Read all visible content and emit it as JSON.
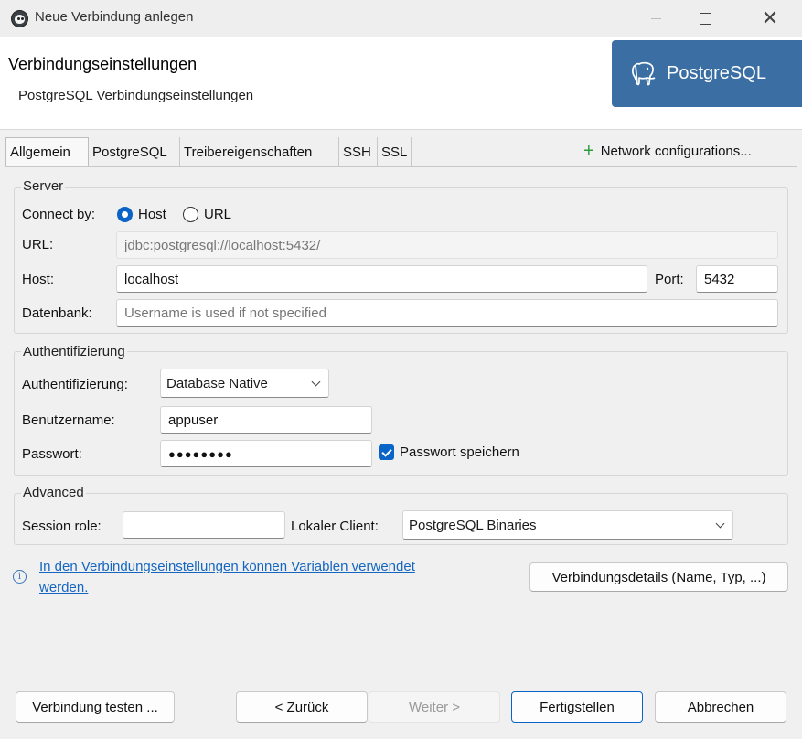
{
  "window": {
    "title": "Neue Verbindung anlegen"
  },
  "header": {
    "title": "Verbindungseinstellungen",
    "subtitle": "PostgreSQL Verbindungseinstellungen",
    "logo_text": "PostgreSQL"
  },
  "tabs": [
    {
      "label": "Allgemein",
      "active": true
    },
    {
      "label": "PostgreSQL"
    },
    {
      "label": "Treibereigenschaften"
    },
    {
      "label": "SSH"
    },
    {
      "label": "SSL"
    }
  ],
  "network_config": "Network configurations...",
  "server": {
    "title": "Server",
    "connect_by_label": "Connect by:",
    "option_host": "Host",
    "option_url": "URL",
    "selected": "Host",
    "url_label": "URL:",
    "url_value": "jdbc:postgresql://localhost:5432/",
    "host_label": "Host:",
    "host_value": "localhost",
    "port_label": "Port:",
    "port_value": "5432",
    "db_label": "Datenbank:",
    "db_placeholder": "Username is used if not specified"
  },
  "auth": {
    "title": "Authentifizierung",
    "auth_label": "Authentifizierung:",
    "auth_value": "Database Native",
    "user_label": "Benutzername:",
    "user_value": "appuser",
    "pass_label": "Passwort:",
    "pass_value": "●●●●●●●●",
    "save_pass_label": "Passwort speichern",
    "save_pass_checked": true
  },
  "advanced": {
    "title": "Advanced",
    "session_role_label": "Session role:",
    "session_role_value": "",
    "local_client_label": "Lokaler Client:",
    "local_client_value": "PostgreSQL Binaries"
  },
  "info": {
    "link_line1": "In den Verbindungseinstellungen können Variablen verwendet",
    "link_line2": "werden.",
    "details_button": "Verbindungsdetails (Name, Typ, ...)"
  },
  "footer": {
    "test": "Verbindung testen ...",
    "back": "< Zurück",
    "next": "Weiter >",
    "finish": "Fertigstellen",
    "cancel": "Abbrechen"
  },
  "colors": {
    "accent": "#0a64c8",
    "logo_bg": "#3b6fa3",
    "link": "#1566c0",
    "plus": "#2e9b3c"
  }
}
